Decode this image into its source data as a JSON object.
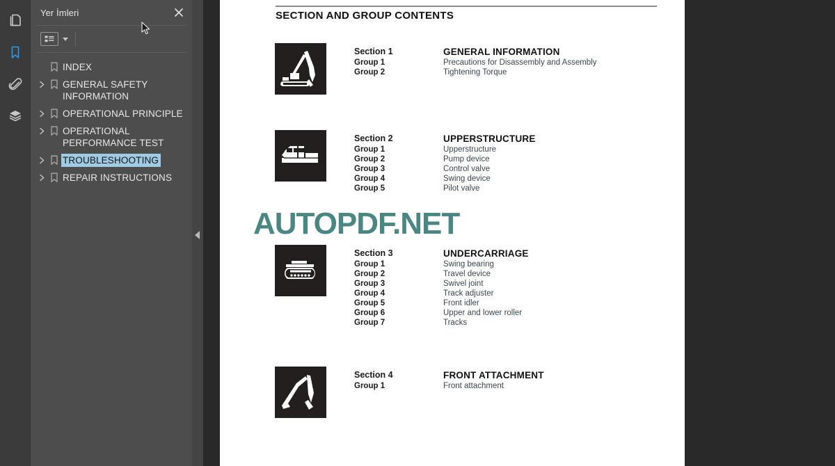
{
  "rail": {
    "items": [
      {
        "name": "pages-icon",
        "label": "Pages",
        "active": false
      },
      {
        "name": "bookmark-icon",
        "label": "Bookmarks",
        "active": true
      },
      {
        "name": "paperclip-icon",
        "label": "Attachments",
        "active": false
      },
      {
        "name": "layers-icon",
        "label": "Layers",
        "active": false
      }
    ]
  },
  "sidebar": {
    "title": "Yer İmleri",
    "close_label": "×",
    "options_icon": "list-options-icon",
    "items": [
      {
        "label": "INDEX",
        "expandable": false,
        "selected": false
      },
      {
        "label": "GENERAL SAFETY INFORMATION",
        "expandable": true,
        "selected": false
      },
      {
        "label": "OPERATIONAL PRINCIPLE",
        "expandable": true,
        "selected": false
      },
      {
        "label": "OPERATIONAL PERFORMANCE TEST",
        "expandable": true,
        "selected": false
      },
      {
        "label": "TROUBLESHOOTING",
        "expandable": true,
        "selected": true
      },
      {
        "label": "REPAIR INSTRUCTIONS",
        "expandable": true,
        "selected": false
      }
    ]
  },
  "document": {
    "title": "SECTION AND GROUP CONTENTS",
    "watermark": "AUTOPDF.NET",
    "watermark_color": "#41807c",
    "sections": [
      {
        "icon": "excavator-full-icon",
        "section_label": "Section 1",
        "section_title": "GENERAL INFORMATION",
        "groups": [
          {
            "label": "Group 1",
            "title": "Precautions for Disassembly and Assembly"
          },
          {
            "label": "Group 2",
            "title": "Tightening Torque"
          }
        ]
      },
      {
        "icon": "upperstructure-icon",
        "section_label": "Section 2",
        "section_title": "UPPERSTRUCTURE",
        "groups": [
          {
            "label": "Group 1",
            "title": "Upperstructure"
          },
          {
            "label": "Group 2",
            "title": "Pump device"
          },
          {
            "label": "Group 3",
            "title": "Control valve"
          },
          {
            "label": "Group 4",
            "title": "Swing device"
          },
          {
            "label": "Group 5",
            "title": "Pilot valve"
          }
        ]
      },
      {
        "icon": "undercarriage-track-icon",
        "section_label": "Section 3",
        "section_title": "UNDERCARRIAGE",
        "groups": [
          {
            "label": "Group 1",
            "title": "Swing bearing"
          },
          {
            "label": "Group 2",
            "title": "Travel device"
          },
          {
            "label": "Group 3",
            "title": "Swivel joint"
          },
          {
            "label": "Group 4",
            "title": "Track adjuster"
          },
          {
            "label": "Group 5",
            "title": "Front idler"
          },
          {
            "label": "Group 6",
            "title": "Upper and lower roller"
          },
          {
            "label": "Group 7",
            "title": "Tracks"
          }
        ]
      },
      {
        "icon": "front-attachment-icon",
        "section_label": "Section 4",
        "section_title": "FRONT ATTACHMENT",
        "groups": [
          {
            "label": "Group 1",
            "title": "Front attachment"
          }
        ]
      }
    ]
  }
}
